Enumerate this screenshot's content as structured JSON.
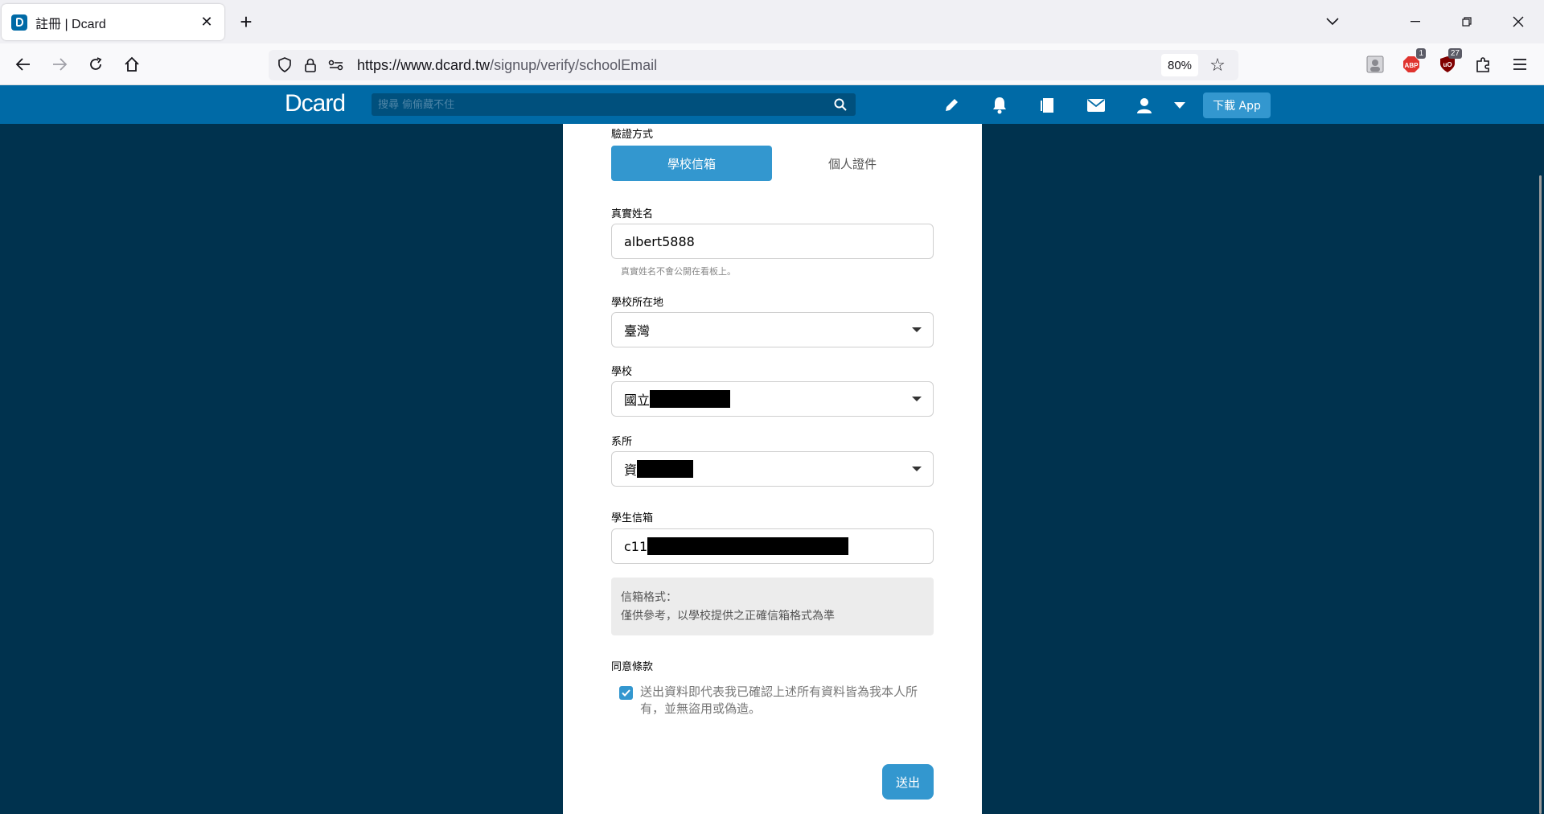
{
  "browser": {
    "tab_title": "註冊 | Dcard",
    "url_host": "https://www.dcard.tw",
    "url_path": "/signup/verify/schoolEmail",
    "zoom": "80%",
    "ext_badges": [
      "1",
      "27"
    ]
  },
  "header": {
    "logo_d": "D",
    "logo_rest": "card",
    "search_placeholder": "搜尋 偷偷藏不住",
    "download_label": "下載 App"
  },
  "form": {
    "method_label": "驗證方式",
    "tab_school_email": "學校信箱",
    "tab_personal_id": "個人證件",
    "realname_label": "真實姓名",
    "realname_value": "albert5888",
    "realname_hint": "真實姓名不會公開在看板上。",
    "location_label": "學校所在地",
    "location_value": "臺灣",
    "school_label": "學校",
    "school_value_visible": "國立",
    "dept_label": "系所",
    "dept_value_visible": "資",
    "email_label": "學生信箱",
    "email_value_visible": "c11",
    "format_title": "信箱格式：",
    "format_note": "僅供參考，以學校提供之正確信箱格式為準",
    "terms_label": "同意條款",
    "terms_text": "送出資料即代表我已確認上述所有資料皆為我本人所有，並無盜用或偽造。",
    "terms_checked": true,
    "submit_label": "送出"
  },
  "colors": {
    "page_bg": "#00324e",
    "header_bg": "#006aa6",
    "accent": "#3397cf"
  }
}
